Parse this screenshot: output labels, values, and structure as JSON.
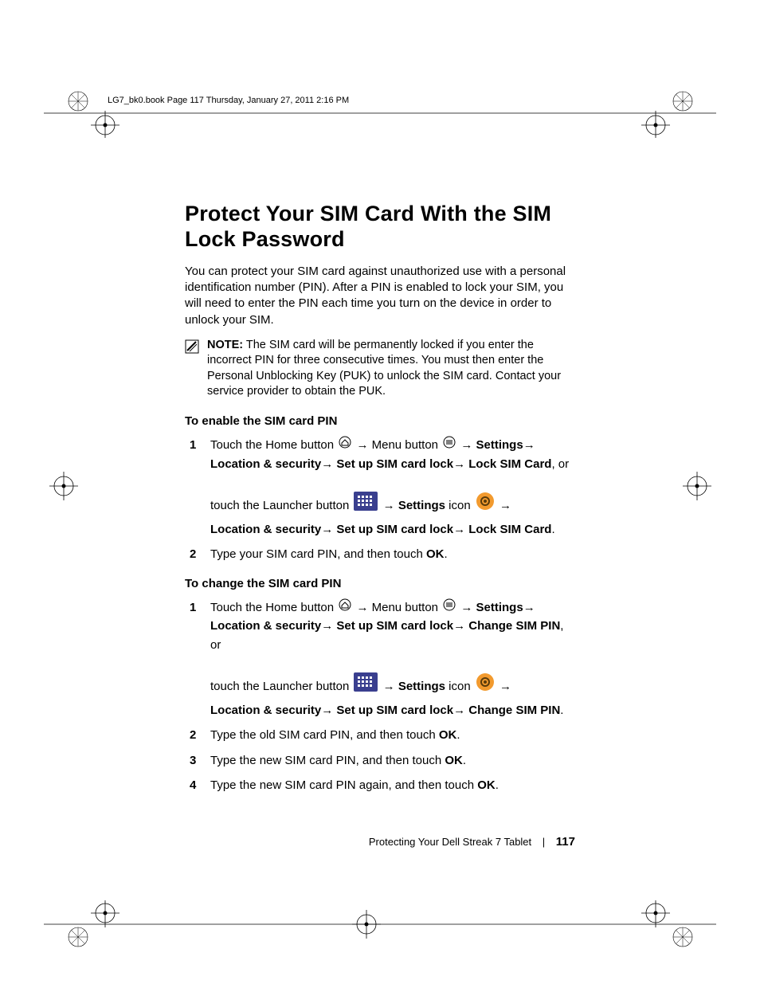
{
  "header": "LG7_bk0.book  Page 117  Thursday, January 27, 2011  2:16 PM",
  "title": "Protect Your SIM Card With the SIM Lock Password",
  "intro": "You can protect your SIM card against unauthorized use with a personal identification number (PIN). After a PIN is enabled to lock your SIM, you will need to enter the PIN each time you turn on the device in order to unlock your SIM.",
  "note": {
    "label": "NOTE:",
    "text": " The SIM card will be permanently locked if you enter the incorrect PIN for three consecutive times. You must then enter the Personal Unblocking Key (PUK) to unlock the SIM card. Contact your service provider to obtain the PUK."
  },
  "sectionA": {
    "heading": "To enable the SIM card PIN",
    "step1": {
      "t1": "Touch the Home button ",
      "t2": " Menu button ",
      "settings": "Settings",
      "loc": "Location & security",
      "setup": "Set up SIM card lock",
      "lock": "Lock SIM Card",
      "or": ", or",
      "t3": "touch the Launcher button ",
      "t4": " icon ",
      "period": "."
    },
    "step2": {
      "a": "Type your SIM card PIN, and then touch ",
      "b": "OK",
      "c": "."
    }
  },
  "sectionB": {
    "heading": "To change the SIM card PIN",
    "step1": {
      "t1": "Touch the Home button ",
      "t2": " Menu button ",
      "settings": "Settings",
      "loc": "Location & security",
      "setup": "Set up SIM card lock",
      "change": "Change SIM PIN",
      "or": ", or",
      "t3": "touch the Launcher button ",
      "t4": " icon ",
      "period": "."
    },
    "step2": {
      "a": "Type the old SIM card PIN, and then touch ",
      "b": "OK",
      "c": "."
    },
    "step3": {
      "a": "Type the new SIM card PIN, and then touch ",
      "b": "OK",
      "c": "."
    },
    "step4": {
      "a": "Type the new SIM card PIN again, and then touch ",
      "b": "OK",
      "c": "."
    }
  },
  "footer": {
    "chapter": "Protecting Your Dell Streak 7 Tablet",
    "page": "117"
  },
  "arrow": "→"
}
